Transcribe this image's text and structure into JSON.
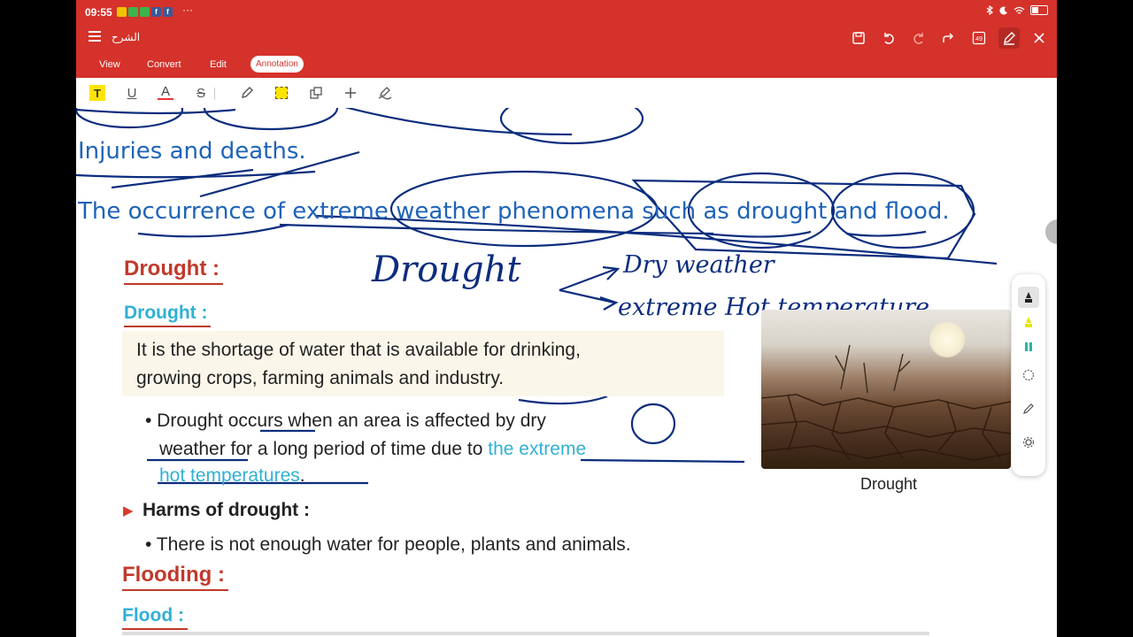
{
  "status": {
    "time": "09:55",
    "more": "···"
  },
  "titlebar": {
    "doc_title": "الشرح"
  },
  "tabs": [
    {
      "label": "View"
    },
    {
      "label": "Convert"
    },
    {
      "label": "Edit"
    },
    {
      "label": "Annotation"
    }
  ],
  "annotation_toolbar": {
    "text_tool": "T",
    "underline_tool": "U",
    "font_color_tool": "A",
    "strike_tool": "S"
  },
  "titlebar_tools": {
    "page_count": "49"
  },
  "handwriting": {
    "injuries": "Injuries and deaths.",
    "occurrence": "The occurrence of extreme weather phenomena such as drought and flood.",
    "drought_word": "Drought",
    "dry_weather": "Dry weather",
    "extreme_hot": "extreme Hot temperature"
  },
  "document": {
    "drought_red": "Drought :",
    "drought_cyan": "Drought :",
    "definition_line1": "It is the shortage of water that is available for drinking,",
    "definition_line2": "growing crops, farming animals and industry.",
    "bullet1_line1": "• Drought occurs when an area is affected by dry",
    "bullet1_line2a": "weather for a long period of time due to ",
    "bullet1_line2b": "the extreme",
    "bullet1_line3a": "hot temperatures",
    "bullet1_line3b": ".",
    "harms_heading": "Harms of drought :",
    "harms_bullet": "• There is not enough water for people, plants and animals.",
    "flooding_red": "Flooding :",
    "flood_cyan": "Flood :",
    "photo_caption": "Drought"
  }
}
